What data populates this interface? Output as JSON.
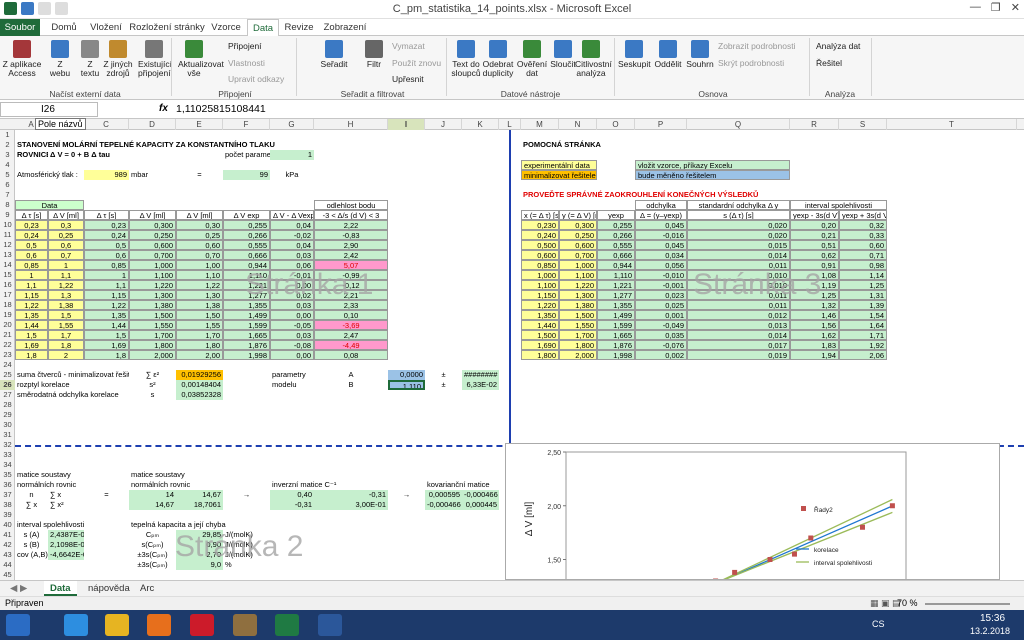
{
  "window": {
    "title": "C_pm_statistika_14_points.xlsx - Microsoft Excel"
  },
  "tabs": [
    "Soubor",
    "Domů",
    "Vložení",
    "Rozložení stránky",
    "Vzorce",
    "Data",
    "Revize",
    "Zobrazení"
  ],
  "ribbon": {
    "buttons": [
      {
        "name": "access-button",
        "label": "Z aplikace\nAccess",
        "x": 2,
        "color": "#a4373a"
      },
      {
        "name": "web-button",
        "label": "Z\nwebu",
        "x": 44,
        "color": "#3b79c4"
      },
      {
        "name": "text-button",
        "label": "Z\ntextu",
        "x": 74,
        "color": "#888"
      },
      {
        "name": "other-sources-button",
        "label": "Z jiných\nzdrojů",
        "x": 102,
        "color": "#c08a2e"
      },
      {
        "name": "existing-connections-button",
        "label": "Existující\npřipojení",
        "x": 138,
        "color": "#777"
      },
      {
        "name": "refresh-all-button",
        "label": "Aktualizovat\nvše",
        "x": 178,
        "color": "#3a8a3a"
      },
      {
        "name": "sort-button",
        "label": "Seřadit",
        "x": 318,
        "color": "#3b79c4"
      },
      {
        "name": "filter-button",
        "label": "Filtr",
        "x": 358,
        "color": "#666"
      },
      {
        "name": "text-to-columns-button",
        "label": "Text do\nsloupců",
        "x": 450,
        "color": "#3b79c4"
      },
      {
        "name": "remove-duplicates-button",
        "label": "Odebrat\nduplicity",
        "x": 482,
        "color": "#3b79c4"
      },
      {
        "name": "data-validation-button",
        "label": "Ověření\ndat",
        "x": 516,
        "color": "#3a8a3a"
      },
      {
        "name": "consolidate-button",
        "label": "Sloučit",
        "x": 547,
        "color": "#3b79c4"
      },
      {
        "name": "what-if-button",
        "label": "Citlivostní\nanalýza",
        "x": 575,
        "color": "#3a8a3a"
      },
      {
        "name": "group-button",
        "label": "Seskupit",
        "x": 618,
        "color": "#3b79c4"
      },
      {
        "name": "ungroup-button",
        "label": "Oddělit",
        "x": 652,
        "color": "#3b79c4"
      },
      {
        "name": "subtotal-button",
        "label": "Souhrn",
        "x": 684,
        "color": "#3b79c4"
      }
    ],
    "small": [
      {
        "name": "connections-item",
        "label": "Připojení",
        "x": 228,
        "y": 5,
        "dis": false
      },
      {
        "name": "properties-item",
        "label": "Vlastnosti",
        "x": 228,
        "y": 22,
        "dis": true
      },
      {
        "name": "edit-links-item",
        "label": "Upravit odkazy",
        "x": 228,
        "y": 38,
        "dis": true
      },
      {
        "name": "clear-item",
        "label": "Vymazat",
        "x": 392,
        "y": 5,
        "dis": true
      },
      {
        "name": "reapply-item",
        "label": "Použít znovu",
        "x": 392,
        "y": 22,
        "dis": true
      },
      {
        "name": "advanced-item",
        "label": "Upřesnit",
        "x": 392,
        "y": 38,
        "dis": false
      },
      {
        "name": "show-detail-item",
        "label": "Zobrazit podrobnosti",
        "x": 718,
        "y": 5,
        "dis": true
      },
      {
        "name": "hide-detail-item",
        "label": "Skrýt podrobnosti",
        "x": 718,
        "y": 22,
        "dis": true
      },
      {
        "name": "data-analysis-item",
        "label": "Analýza dat",
        "x": 816,
        "y": 5,
        "dis": false
      },
      {
        "name": "solver-item",
        "label": "Řešitel",
        "x": 816,
        "y": 22,
        "dis": false
      }
    ],
    "groups": [
      {
        "label": "Načíst externí data",
        "x": 0,
        "w": 170
      },
      {
        "label": "Připojení",
        "x": 175,
        "w": 120
      },
      {
        "label": "Seřadit a filtrovat",
        "x": 300,
        "w": 145
      },
      {
        "label": "Datové nástroje",
        "x": 448,
        "w": 165
      },
      {
        "label": "Osnova",
        "x": 618,
        "w": 190
      },
      {
        "label": "Analýza",
        "x": 810,
        "w": 60
      }
    ]
  },
  "formula_bar": {
    "name_box": "I26",
    "fx": "fx",
    "value": "1,11025815108441",
    "tooltip": "Pole názvů"
  },
  "columns": [
    {
      "l": "A",
      "x": 15,
      "w": 33
    },
    {
      "l": "B",
      "x": 48,
      "w": 36
    },
    {
      "l": "C",
      "x": 84,
      "w": 45
    },
    {
      "l": "D",
      "x": 129,
      "w": 47
    },
    {
      "l": "E",
      "x": 176,
      "w": 47
    },
    {
      "l": "F",
      "x": 223,
      "w": 47
    },
    {
      "l": "G",
      "x": 270,
      "w": 44
    },
    {
      "l": "H",
      "x": 314,
      "w": 74
    },
    {
      "l": "I",
      "x": 388,
      "w": 37
    },
    {
      "l": "J",
      "x": 425,
      "w": 37
    },
    {
      "l": "K",
      "x": 462,
      "w": 37
    },
    {
      "l": "L",
      "x": 499,
      "w": 22
    },
    {
      "l": "M",
      "x": 521,
      "w": 38
    },
    {
      "l": "N",
      "x": 559,
      "w": 38
    },
    {
      "l": "O",
      "x": 597,
      "w": 38
    },
    {
      "l": "P",
      "x": 635,
      "w": 52
    },
    {
      "l": "Q",
      "x": 687,
      "w": 103
    },
    {
      "l": "R",
      "x": 790,
      "w": 49
    },
    {
      "l": "S",
      "x": 839,
      "w": 48
    },
    {
      "l": "T",
      "x": 887,
      "w": 130
    }
  ],
  "rows": [
    "1",
    "2",
    "3",
    "4",
    "5",
    "6",
    "7",
    "8",
    "9",
    "10",
    "11",
    "12",
    "13",
    "14",
    "15",
    "16",
    "17",
    "18",
    "19",
    "20",
    "21",
    "22",
    "23",
    "24",
    "25",
    "26",
    "27",
    "28",
    "29",
    "30",
    "31",
    "32",
    "33",
    "34",
    "35",
    "36",
    "37",
    "38",
    "39",
    "40",
    "41",
    "42",
    "43",
    "44",
    "45"
  ],
  "texts": {
    "title": "STANOVENÍ MOLÁRNÍ TEPELNÉ KAPACITY ZA KONSTANTNÍHO TLAKU",
    "rovnice": "ROVNICE",
    "equation": "Δ V = 0 + B Δ tau",
    "pocet_label": "počet parametrů",
    "pocet_val": "1",
    "atm_label": "Atmosférický tlak :",
    "atm_val": "989",
    "atm_unit": "mbar",
    "eq": "=",
    "atm_kpa": "99",
    "kpa": "kPa",
    "data": "Data",
    "odl_head": "odlehlost bodu",
    "odl_sub": "-3 < Δ/s (d V) < 3",
    "h_dt": "Δ τ [s]",
    "h_dv": "Δ V [ml]",
    "h_dt2": "Δ τ [s]",
    "h_dv2": "Δ V [ml]",
    "h_dv3": "Δ V [ml]",
    "h_vexp": "Δ V exp",
    "h_dd": "Δ V - Δ Vexp",
    "sum_label": "suma čtverců - minimalizovat řešitelem",
    "sum_sym": "∑ ε²",
    "sum_val": "0,01929256",
    "rozptyl_label": "rozptyl korelace",
    "rozptyl_sym": "s²",
    "rozptyl_val": "0,00148404",
    "smod_label": "směrodatná odchylka korelace",
    "smod_sym": "s",
    "smod_val": "0,03852328",
    "param_label": "parametry",
    "modelu_label": "modelu",
    "pA": "A",
    "pB": "B",
    "pA_val": "0,0000",
    "pB_val": "1,110",
    "pm": "±",
    "pA_err": "########",
    "pB_err": "6,33E-02",
    "matice1a": "matice soustavy",
    "matice1b": "normálních rovnic",
    "mn": "n",
    "msx": "∑ x",
    "msx2": "∑ x²",
    "eq2": "=",
    "matice2a": "matice soustavy",
    "matice2b": "normálních rovnic",
    "m2_1": "14",
    "m2_2": "14,67",
    "m2_3": "14,67",
    "m2_4": "18,7061",
    "arrow": "→",
    "inv_label": "inverzní matice C⁻¹",
    "inv1": "0,40",
    "inv2": "-0,31",
    "inv3": "-0,31",
    "inv4": "3,00E-01",
    "kov_label": "kovarianční matice",
    "kov1": "0,000595",
    "kov2": "-0,000466",
    "kov3": "-0,000466",
    "kov4": "0,000445",
    "int_label": "interval spolehlivosti",
    "sA": "s (A)",
    "sB": "s (B)",
    "cov": "cov (A,B)",
    "sA_val": "2,4387E-02",
    "sB_val": "2,1098E-02",
    "cov_val": "-4,6642E-04",
    "tep_label": "tepelná kapacita a její chyba",
    "cpm": "Cₚₘ",
    "scpm": "s(Cₚₘ)",
    "ps3": "±3s(Cₚₘ)",
    "pspm": "±3s(Cₚₘ)",
    "cpm_val": "29,85",
    "scpm_val": "0,90",
    "ps3_val": "2,70",
    "pspm_val": "9,0",
    "jmolk": "J/(molK)",
    "pct": "%",
    "pom": "POMOCNÁ STRÁNKA",
    "leg1": "experimentální data",
    "leg1b": "vložit vzorce, příkazy Excelu",
    "leg2": "minimalizovat řešitelem",
    "leg2b": "bude měněno řešitelem",
    "zaokr": "PROVEĎTE SPRÁVNÉ ZAOKROUHLENÍ KONEČNÝCH VÝSLEDKŮ",
    "h_x": "x (= Δ τ) [s]",
    "h_y": "y (= Δ V) [ml]",
    "h_yexp": "yexp",
    "h_odch": "odchylka",
    "h_delta": "Δ = (y–yexp)",
    "h_std": "standardní odchylka Δ y",
    "h_sdt": "s (Δ τ) [s]",
    "h_int": "interval spolehlivosti",
    "h_lo": "yexp - 3s(d V)",
    "h_hi": "yexp + 3s(d V)",
    "wm1": "Stránka 1",
    "wm2": "Stránka 2",
    "wm3": "Stránka 3"
  },
  "data_rows": [
    [
      "0,23",
      "0,3",
      "0,23",
      "0,300",
      "0,30",
      "0,255",
      "0,04",
      "2,22",
      ""
    ],
    [
      "0,24",
      "0,25",
      "0,24",
      "0,250",
      "0,25",
      "0,266",
      "-0,02",
      "-0,83",
      ""
    ],
    [
      "0,5",
      "0,6",
      "0,5",
      "0,600",
      "0,60",
      "0,555",
      "0,04",
      "2,90",
      ""
    ],
    [
      "0,6",
      "0,7",
      "0,6",
      "0,700",
      "0,70",
      "0,666",
      "0,03",
      "2,42",
      ""
    ],
    [
      "0,85",
      "1",
      "0,85",
      "1,000",
      "1,00",
      "0,944",
      "0,06",
      "5,07",
      "p"
    ],
    [
      "1",
      "1,1",
      "1",
      "1,100",
      "1,10",
      "1,110",
      "-0,01",
      "-0,99",
      ""
    ],
    [
      "1,1",
      "1,22",
      "1,1",
      "1,220",
      "1,22",
      "1,221",
      "0,00",
      "-0,12",
      ""
    ],
    [
      "1,15",
      "1,3",
      "1,15",
      "1,300",
      "1,30",
      "1,277",
      "0,02",
      "2,21",
      ""
    ],
    [
      "1,22",
      "1,38",
      "1,22",
      "1,380",
      "1,38",
      "1,355",
      "0,03",
      "2,33",
      ""
    ],
    [
      "1,35",
      "1,5",
      "1,35",
      "1,500",
      "1,50",
      "1,499",
      "0,00",
      "0,10",
      ""
    ],
    [
      "1,44",
      "1,55",
      "1,44",
      "1,550",
      "1,55",
      "1,599",
      "-0,05",
      "-3,69",
      "p"
    ],
    [
      "1,5",
      "1,7",
      "1,5",
      "1,700",
      "1,70",
      "1,665",
      "0,03",
      "2,47",
      ""
    ],
    [
      "1,69",
      "1,8",
      "1,69",
      "1,800",
      "1,80",
      "1,876",
      "-0,08",
      "-4,49",
      "p"
    ],
    [
      "1,8",
      "2",
      "1,8",
      "2,000",
      "2,00",
      "1,998",
      "0,00",
      "0,08",
      ""
    ]
  ],
  "right_rows": [
    [
      "0,230",
      "0,300",
      "0,255",
      "0,045",
      "0,020",
      "0,20",
      "0,32"
    ],
    [
      "0,240",
      "0,250",
      "0,266",
      "-0,016",
      "0,020",
      "0,21",
      "0,33"
    ],
    [
      "0,500",
      "0,600",
      "0,555",
      "0,045",
      "0,015",
      "0,51",
      "0,60"
    ],
    [
      "0,600",
      "0,700",
      "0,666",
      "0,034",
      "0,014",
      "0,62",
      "0,71"
    ],
    [
      "0,850",
      "1,000",
      "0,944",
      "0,056",
      "0,011",
      "0,91",
      "0,98"
    ],
    [
      "1,000",
      "1,100",
      "1,110",
      "-0,010",
      "0,010",
      "1,08",
      "1,14"
    ],
    [
      "1,100",
      "1,220",
      "1,221",
      "-0,001",
      "0,010",
      "1,19",
      "1,25"
    ],
    [
      "1,150",
      "1,300",
      "1,277",
      "0,023",
      "0,011",
      "1,25",
      "1,31"
    ],
    [
      "1,220",
      "1,380",
      "1,355",
      "0,025",
      "0,011",
      "1,32",
      "1,39"
    ],
    [
      "1,350",
      "1,500",
      "1,499",
      "0,001",
      "0,012",
      "1,46",
      "1,54"
    ],
    [
      "1,440",
      "1,550",
      "1,599",
      "-0,049",
      "0,013",
      "1,56",
      "1,64"
    ],
    [
      "1,500",
      "1,700",
      "1,665",
      "0,035",
      "0,014",
      "1,62",
      "1,71"
    ],
    [
      "1,690",
      "1,800",
      "1,876",
      "-0,076",
      "0,017",
      "1,83",
      "1,92"
    ],
    [
      "1,800",
      "2,000",
      "1,998",
      "0,002",
      "0,019",
      "1,94",
      "2,06"
    ]
  ],
  "chart_data": {
    "type": "scatter",
    "ylabel": "Δ V [ml]",
    "yticks": [
      "2,50",
      "2,00",
      "1,50"
    ],
    "ylim": [
      1.3,
      2.5
    ],
    "series": [
      {
        "name": "Řady2",
        "type": "scatter",
        "color": "#c0504d",
        "x": [
          0.85,
          1,
          1.1,
          1.15,
          1.22,
          1.35,
          1.44,
          1.5,
          1.69,
          1.8
        ],
        "y": [
          1,
          1.1,
          1.22,
          1.3,
          1.38,
          1.5,
          1.55,
          1.7,
          1.8,
          2
        ]
      },
      {
        "name": "korelace",
        "type": "line",
        "color": "#1f77d0"
      },
      {
        "name": "interval spolehlivosti",
        "type": "line",
        "color": "#9bbb59"
      }
    ],
    "xlim": [
      0.6,
      1.85
    ]
  },
  "sheet_tabs": [
    "Data",
    "nápověda",
    "Arc"
  ],
  "status": {
    "left": "Připraven",
    "zoom": "70 %"
  },
  "taskbar": {
    "lang": "CS",
    "time": "15:36",
    "date": "13.2.2018"
  }
}
